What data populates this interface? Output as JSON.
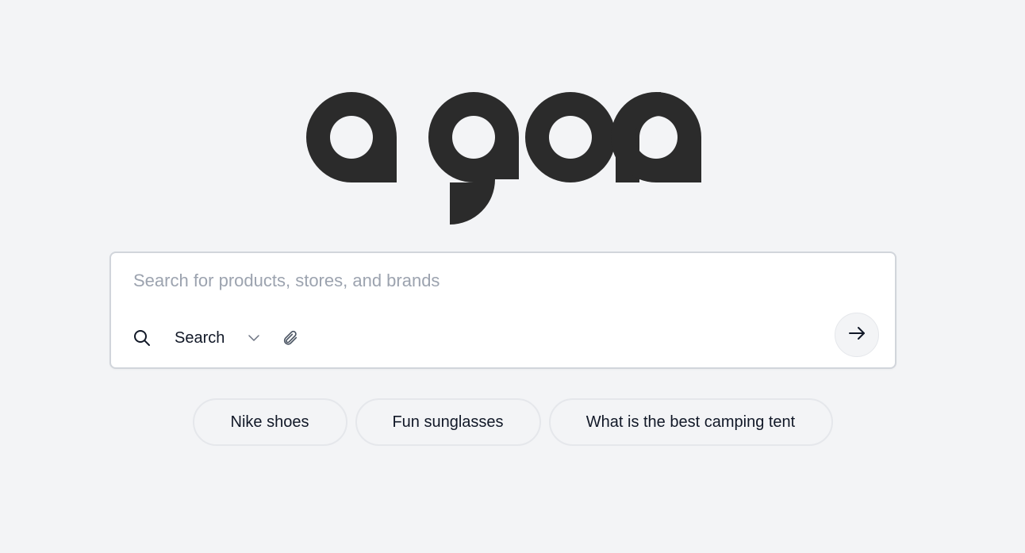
{
  "logo": {
    "text": "agora",
    "color": "#2b2b2b"
  },
  "search": {
    "placeholder": "Search for products, stores, and brands",
    "value": "",
    "mode_label": "Search",
    "icons": {
      "search": "search-icon",
      "chevron": "chevron-down-icon",
      "attach": "paperclip-icon",
      "submit": "arrow-right-icon"
    }
  },
  "suggestions": [
    {
      "label": "Nike shoes"
    },
    {
      "label": "Fun sunglasses"
    },
    {
      "label": "What is the best camping tent"
    }
  ],
  "colors": {
    "background": "#f3f4f6",
    "card": "#ffffff",
    "border": "#d1d5db",
    "placeholder": "#9ca3af"
  }
}
